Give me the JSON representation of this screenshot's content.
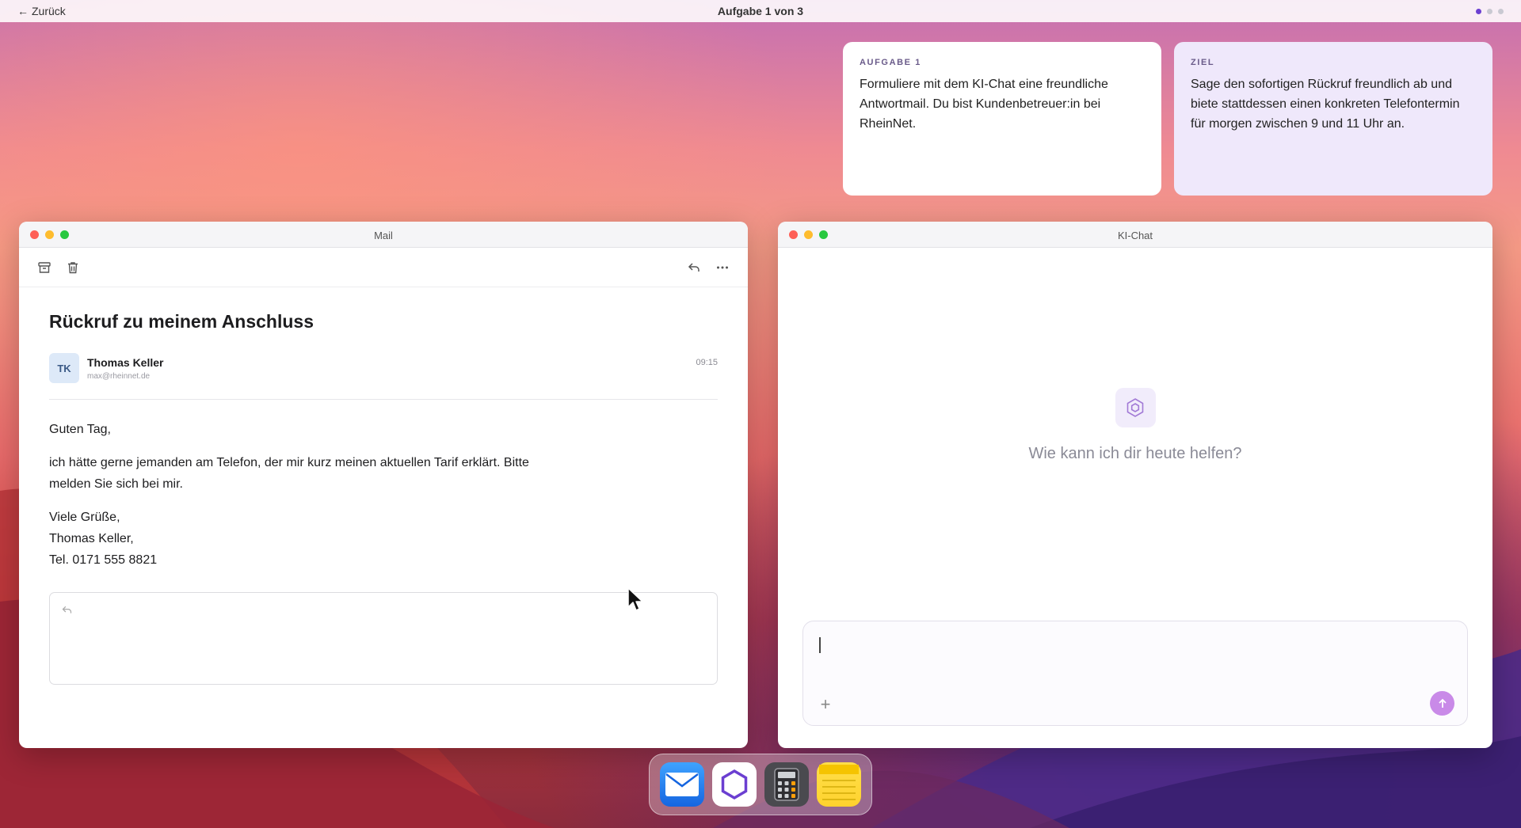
{
  "topbar": {
    "back_label": "Zurück",
    "title": "Aufgabe 1 von 3",
    "step_total": 3,
    "step_current": 1
  },
  "task_card": {
    "label": "AUFGABE 1",
    "text": "Formuliere mit dem KI-Chat eine freundliche Antwortmail. Du bist Kundenbetreuer:in bei RheinNet."
  },
  "goal_card": {
    "label": "ZIEL",
    "text": "Sage den sofortigen Rückruf freundlich ab und biete stattdessen einen konkreten Telefontermin für morgen zwischen 9 und 11 Uhr an."
  },
  "mail_window": {
    "title": "Mail",
    "toolbar_icons": [
      "archive-icon",
      "trash-icon",
      "reply-icon",
      "more-icon"
    ],
    "subject": "Rückruf zu meinem Anschluss",
    "sender": {
      "initials": "TK",
      "name": "Thomas Keller",
      "email": "max@rheinnet.de",
      "time": "09:15"
    },
    "body": {
      "greeting": "Guten Tag,",
      "paragraph": "ich hätte gerne jemanden am Telefon, der mir kurz meinen aktuellen Tarif erklärt. Bitte melden Sie sich bei mir.",
      "closing_1": "Viele Grüße,",
      "closing_2": "Thomas Keller,",
      "closing_3": "Tel. 0171 555 8821"
    }
  },
  "chat_window": {
    "title": "KI-Chat",
    "greeting": "Wie kann ich dir heute helfen?",
    "input_value": ""
  },
  "dock": {
    "apps": [
      "mail-app",
      "ki-chat-app",
      "calculator-app",
      "notes-app"
    ]
  },
  "colors": {
    "accent": "#6b3fd1",
    "send_button": "#c98ae8",
    "goal_card_bg": "#efe8fb"
  }
}
